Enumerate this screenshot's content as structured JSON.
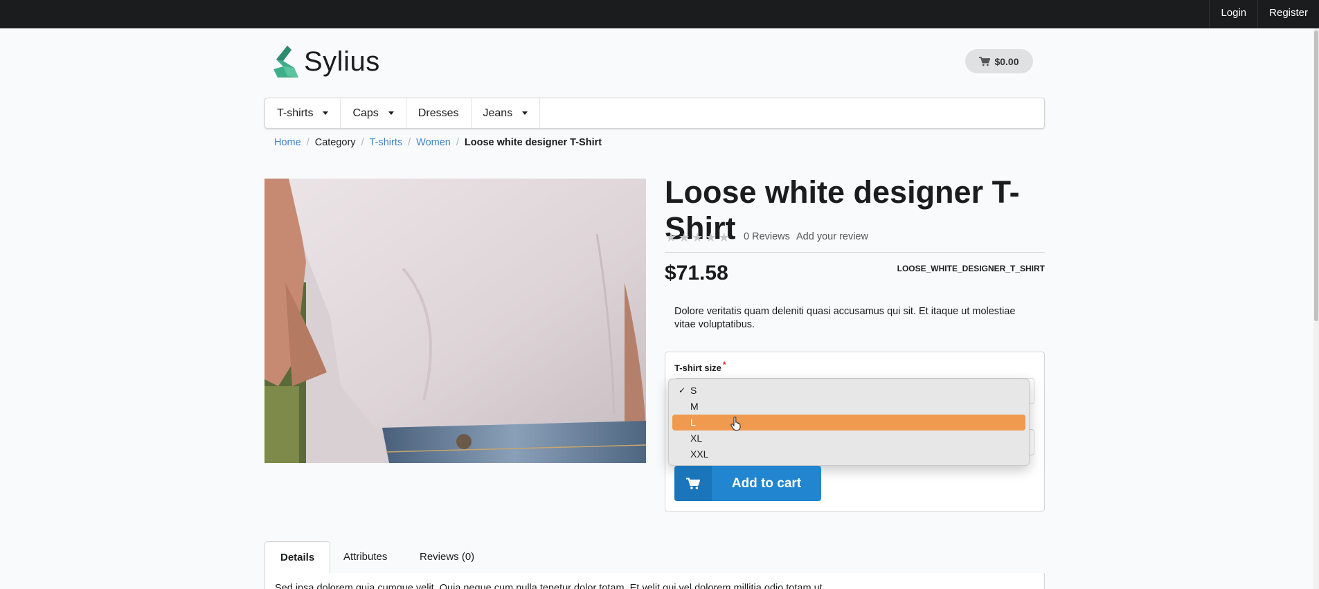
{
  "topbar": {
    "login": "Login",
    "register": "Register"
  },
  "header": {
    "logo_text": "Sylius",
    "cart_total": "$0.00"
  },
  "menu": {
    "items": [
      {
        "label": "T-shirts",
        "has_dropdown": true
      },
      {
        "label": "Caps",
        "has_dropdown": true
      },
      {
        "label": "Dresses",
        "has_dropdown": false
      },
      {
        "label": "Jeans",
        "has_dropdown": true
      }
    ]
  },
  "breadcrumb": {
    "home": "Home",
    "category": "Category",
    "tshirts": "T-shirts",
    "women": "Women",
    "current": "Loose white designer T-Shirt",
    "separator": "/"
  },
  "product": {
    "title": "Loose white designer T-Shirt",
    "rating": 0,
    "reviews_count": "0 Reviews",
    "add_review": "Add your review",
    "price": "$71.58",
    "sku": "LOOSE_WHITE_DESIGNER_T_SHIRT",
    "description": "Dolore veritatis quam deleniti quasi accusamus qui sit. Et itaque ut molestiae vitae voluptatibus."
  },
  "form": {
    "size_label": "T-shirt size",
    "required_mark": "*",
    "size_options": [
      "S",
      "M",
      "L",
      "XL",
      "XXL"
    ],
    "selected_option": "S",
    "highlighted_option": "L",
    "checkmark": "✓",
    "add_to_cart": "Add to cart"
  },
  "tabs": {
    "details": "Details",
    "attributes": "Attributes",
    "reviews": "Reviews (0)",
    "active": "Details",
    "content_preview": "Sed ipsa dolorem quia cumque velit. Quia neque cum nulla tenetur dolor totam. Et velit qui vel dolorem millitia odio totam ut."
  },
  "colors": {
    "topbar": "#1b1c1d",
    "link": "#4183c4",
    "primary_button": "#2185d0",
    "highlight": "#f09a4f",
    "logo_green": "#3fae88"
  },
  "icons": {
    "cart": "cart-icon",
    "star": "star-icon",
    "caret": "caret-down-icon",
    "cursor": "hand-pointer-icon"
  }
}
